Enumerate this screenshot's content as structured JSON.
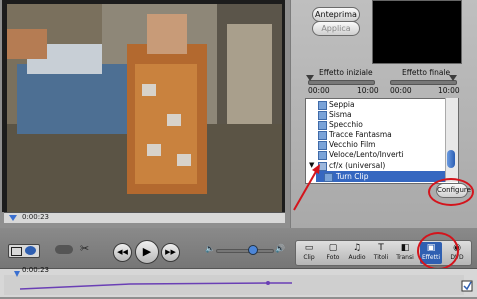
{
  "viewer": {
    "timecode": "0:00:23"
  },
  "preview_buttons": {
    "preview": "Anteprima",
    "apply": "Applica"
  },
  "effect_in": {
    "label": "Effetto iniziale",
    "min": "00:00",
    "max": "10:00",
    "value": "00:00"
  },
  "effect_out": {
    "label": "Effetto finale",
    "min": "00:00",
    "max": "10:00",
    "value": "00:00"
  },
  "effects_list": [
    {
      "label": "Seppia",
      "type": "effect"
    },
    {
      "label": "Sisma",
      "type": "effect"
    },
    {
      "label": "Specchio",
      "type": "effect"
    },
    {
      "label": "Tracce Fantasma",
      "type": "effect"
    },
    {
      "label": "Vecchio Film",
      "type": "effect"
    },
    {
      "label": "Veloce/Lento/Inverti",
      "type": "effect"
    },
    {
      "label": "cf/x (universal)",
      "type": "folder"
    },
    {
      "label": "Turn Clip",
      "type": "child"
    }
  ],
  "configure_button": "Configure",
  "toolbar": {
    "items": [
      {
        "label": "Clip",
        "icon": "clip-icon"
      },
      {
        "label": "Foto",
        "icon": "photo-icon"
      },
      {
        "label": "Audio",
        "icon": "audio-icon"
      },
      {
        "label": "Titoli",
        "icon": "titles-icon"
      },
      {
        "label": "Transi",
        "icon": "transitions-icon"
      },
      {
        "label": "Effetti",
        "icon": "effects-icon"
      },
      {
        "label": "DVD",
        "icon": "dvd-icon"
      }
    ],
    "selected": "Effetti"
  },
  "timeline": {
    "timecode": "0:00:23"
  },
  "colors": {
    "accent": "#2f5fb1",
    "annotation": "#d4141c"
  }
}
